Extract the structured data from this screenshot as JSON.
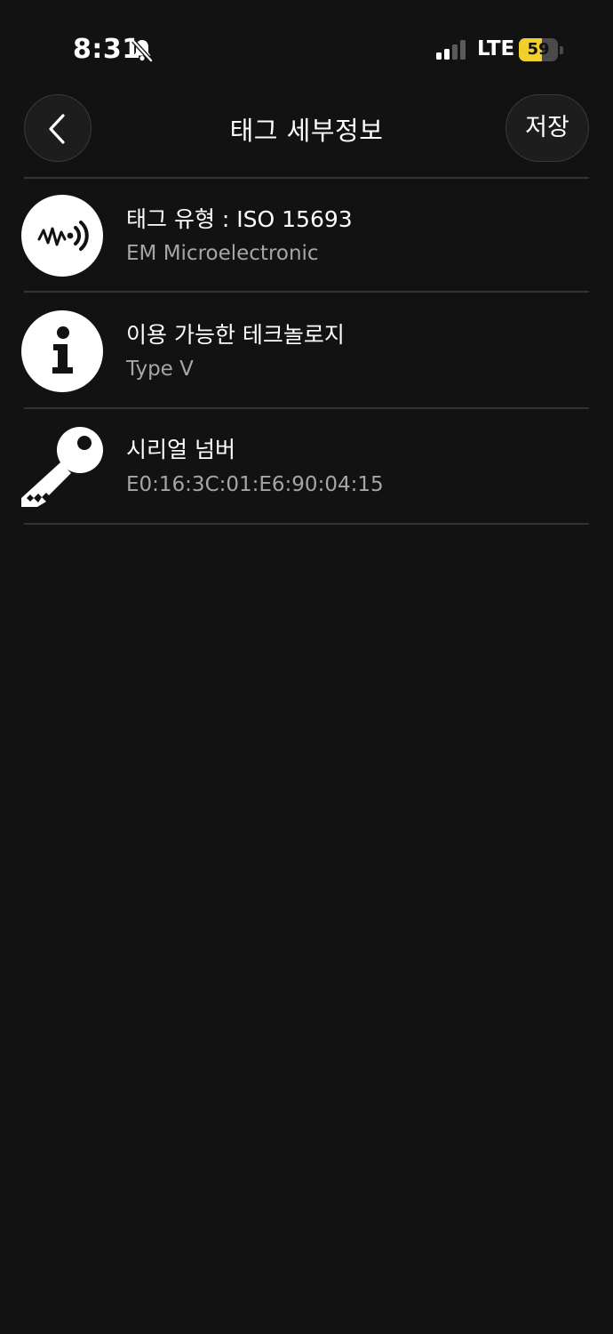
{
  "status_bar": {
    "time": "8:31",
    "network": "LTE",
    "battery_level": "59",
    "battery_fraction": 0.59,
    "battery_color": "#f2cf2b",
    "icons": [
      "bell-slash-icon",
      "signal-bars-icon",
      "battery-icon"
    ]
  },
  "header": {
    "title": "태그 세부정보",
    "save_label": "저장",
    "back_icon": "chevron-left-icon"
  },
  "details": [
    {
      "icon": "nfc-signal-icon",
      "title": "태그 유형 : ISO 15693",
      "value": "EM Microelectronic"
    },
    {
      "icon": "info-icon",
      "title": "이용 가능한 테크놀로지",
      "value": "Type V"
    },
    {
      "icon": "key-icon",
      "title": "시리얼 넘버",
      "value": "E0:16:3C:01:E6:90:04:15"
    }
  ]
}
